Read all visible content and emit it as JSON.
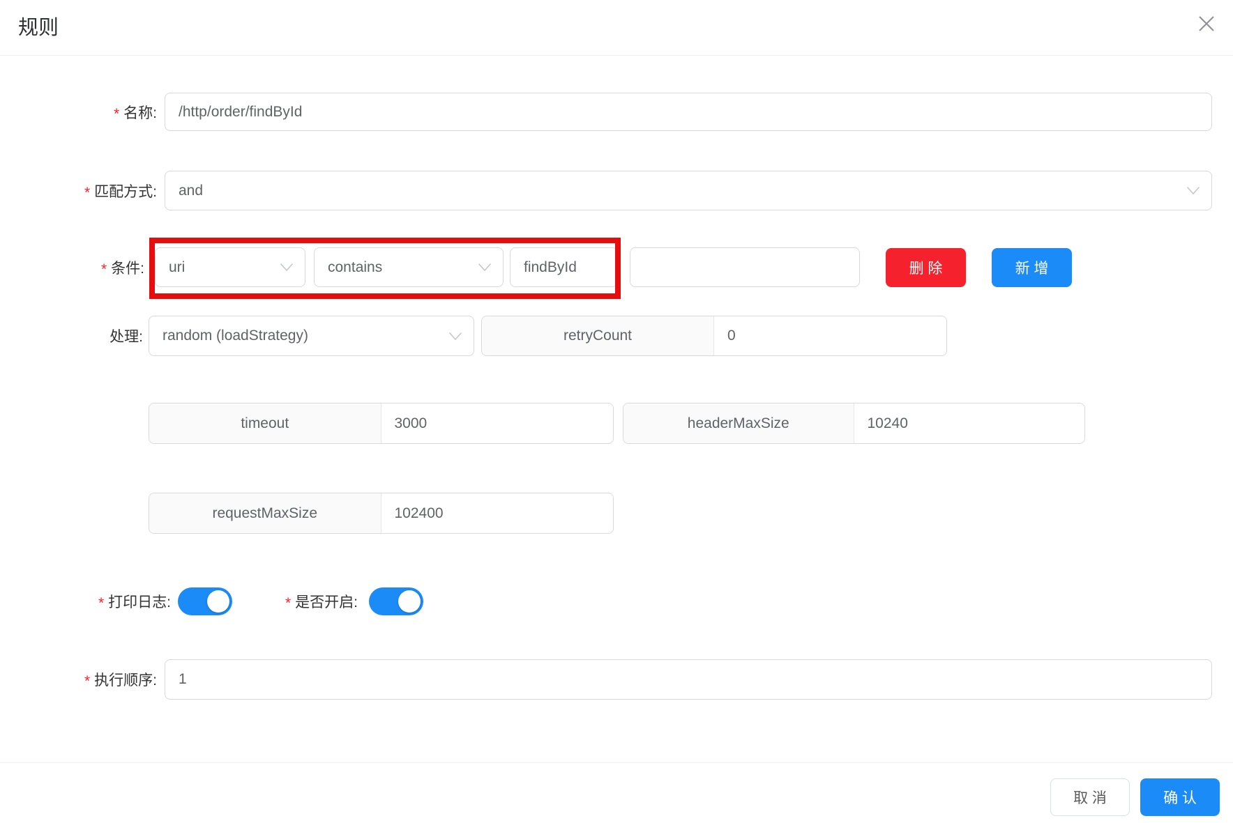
{
  "dialog": {
    "title": "规则"
  },
  "ui": {
    "required_mark": "*"
  },
  "form": {
    "name": {
      "label": "名称:",
      "value": "/http/order/findById"
    },
    "match": {
      "label": "匹配方式:",
      "value": "and"
    },
    "condition": {
      "label": "条件:",
      "field": "uri",
      "operator": "contains",
      "keyword": "findById",
      "extra": "",
      "delete_label": "删 除",
      "add_label": "新 增"
    },
    "handle": {
      "label": "处理:",
      "strategy": "random (loadStrategy)",
      "params": [
        {
          "key": "retryCount",
          "value": "0"
        },
        {
          "key": "timeout",
          "value": "3000"
        },
        {
          "key": "headerMaxSize",
          "value": "10240"
        },
        {
          "key": "requestMaxSize",
          "value": "102400"
        }
      ]
    },
    "print_log": {
      "label": "打印日志:",
      "state": "on"
    },
    "enabled": {
      "label": "是否开启:",
      "state": "on"
    },
    "order": {
      "label": "执行顺序:",
      "value": "1"
    }
  },
  "footer": {
    "cancel_label": "取 消",
    "confirm_label": "确 认"
  },
  "colors": {
    "primary": "#1b8bf8",
    "danger": "#f5222d",
    "annotation": "#e60d0d",
    "border": "#d9d9d9"
  }
}
